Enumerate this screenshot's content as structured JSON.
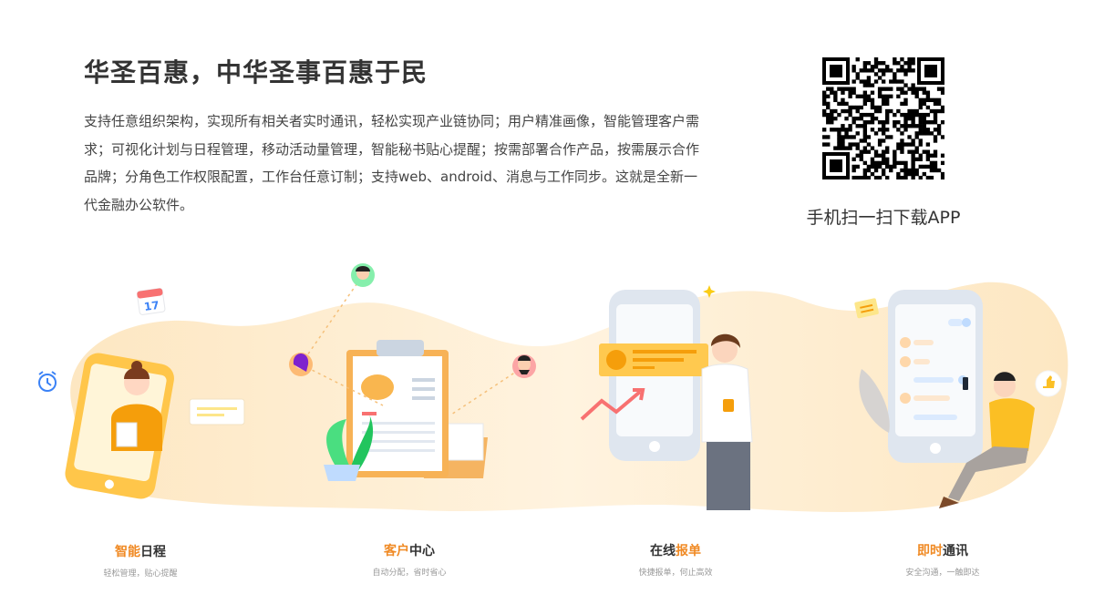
{
  "header": {
    "title": "华圣百惠，中华圣事百惠于民",
    "description": "支持任意组织架构，实现所有相关者实时通讯，轻松实现产业链协同；用户精准画像，智能管理客户需求；可视化计划与日程管理，移动活动量管理，智能秘书贴心提醒；按需部署合作产品，按需展示合作品牌；分角色工作权限配置，工作台任意订制；支持web、android、消息与工作同步。这就是全新一代金融办公软件。"
  },
  "download": {
    "caption": "手机扫一扫下载APP"
  },
  "calendar": {
    "day": "17"
  },
  "features": [
    {
      "title_a": "智能",
      "title_b": "日程",
      "subtitle": "轻松管理，贴心提醒"
    },
    {
      "title_a": "客户",
      "title_b": "中心",
      "subtitle": "自动分配，省时省心"
    },
    {
      "title_a": "在线",
      "title_b": "报单",
      "subtitle": "快捷报单，何止高效"
    },
    {
      "title_a": "即时",
      "title_b": "通讯",
      "subtitle": "安全沟通，一触即达"
    }
  ],
  "colors": {
    "accent": "#f08a24",
    "blob": "#fdebc8",
    "phone_yellow": "#ffc64a"
  }
}
